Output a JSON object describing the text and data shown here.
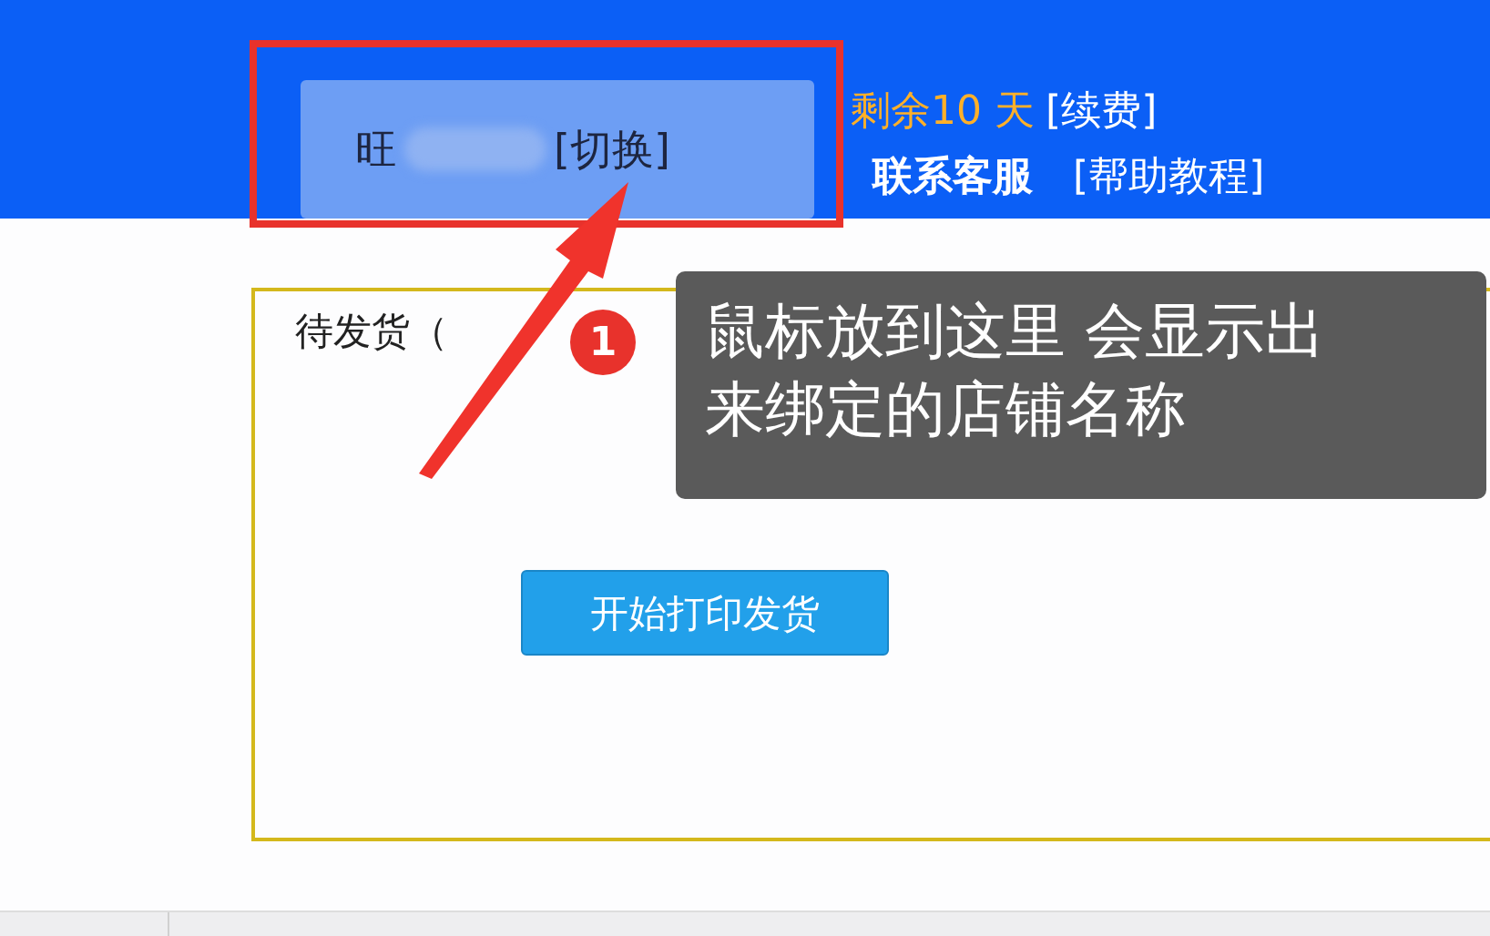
{
  "header": {
    "store_selector": {
      "name": "旺",
      "switch": "[切换]"
    },
    "remaining": "剩余10 天",
    "renew": "[续费]",
    "contact": "联系客服",
    "help": "[帮助教程]"
  },
  "panel": {
    "status": "待发货（",
    "button": "开始打印发货"
  },
  "annotation": {
    "badge": "1",
    "tooltip": "鼠标放到这里 会显示出来绑定的店铺名称"
  }
}
